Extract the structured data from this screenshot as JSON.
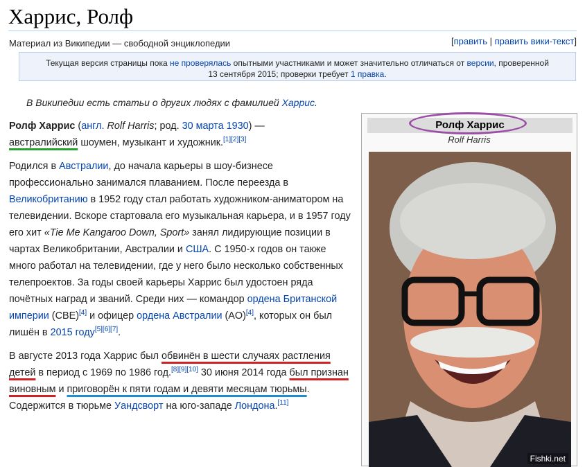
{
  "page": {
    "title": "Харрис, Ролф",
    "subtitle": "Материал из Википедии — свободной энциклопедии",
    "edit_links": {
      "open": "[",
      "edit": "править",
      "sep": " | ",
      "edit_wiki": "править вики-текст",
      "close": "]"
    }
  },
  "notice": {
    "t1": "Текущая версия страницы пока ",
    "link1": "не проверялась",
    "t2": " опытными участниками и может значительно отличаться от ",
    "link2": "версии",
    "t3": ", проверенной",
    "t4": "13 сентября 2015; проверки требует ",
    "link3": "1 правка",
    "t5": "."
  },
  "hatnote": {
    "text": "В Википедии есть статьи о других людях с фамилией ",
    "link": "Харрис",
    "end": "."
  },
  "p1": {
    "name": "Ролф Харрис",
    "t1": " (",
    "lang": "англ.",
    "t2": " ",
    "orig": "Rolf Harris",
    "t3": "; род. ",
    "date": "30 марта 1930",
    "t4": ") —",
    "nat": "австралийский",
    "t5": " шоумен, музыкант и художник.",
    "refs": "[1][2][3]"
  },
  "p2": {
    "t1": "Родился в ",
    "l1": "Австралии",
    "t2": ", до начала карьеры в шоу-бизнесе профессионально занимался плаванием. После переезда в ",
    "l2": "Великобританию",
    "t3": " в 1952 году стал работать художником-аниматором на телевидении. Вскоре стартовала его музыкальная карьера, и в 1957 году его хит ",
    "song": "«Tie Me Kangaroo Down, Sport»",
    "t4": " занял лидирующие позиции в чартах Великобритании, Австралии и ",
    "l3": "США",
    "t5": ". С 1950-х годов он также много работал на телевидении, где у него было несколько собственных телепроектов. За годы своей карьеры Харрис был удостоен ряда почётных наград и званий. Среди них — командор ",
    "l4": "ордена Британской империи",
    "t6": " (CBE)",
    "r4": "[4]",
    "t7": " и офицер ",
    "l5": "ордена Австралии",
    "t8": " (AO)",
    "r4b": "[4]",
    "t9": ", которых он был лишён в ",
    "l6": "2015 году",
    "refs": "[5][6][7]",
    "t10": "."
  },
  "p3": {
    "t1": "В августе 2013 года Харрис был ",
    "u1": "обвинён в шести случаях растления детей",
    "t2": " в период с 1969 по 1986 год.",
    "r1": "[8][9][10]",
    "t3": " 30 июня 2014 года ",
    "u2": "был признан виновным",
    "t4": " и ",
    "u3": "приговорён к пяти годам и девяти месяцам тюрьмы",
    "t5": ". Содержится в тюрьме ",
    "l1": "Уандсворт",
    "t6": " на юго-западе ",
    "l2": "Лондона",
    "t7": ".",
    "r2": "[11]"
  },
  "infobox": {
    "name": "Ролф Харрис",
    "native": "Rolf Harris"
  },
  "watermark": "Fishki.net"
}
